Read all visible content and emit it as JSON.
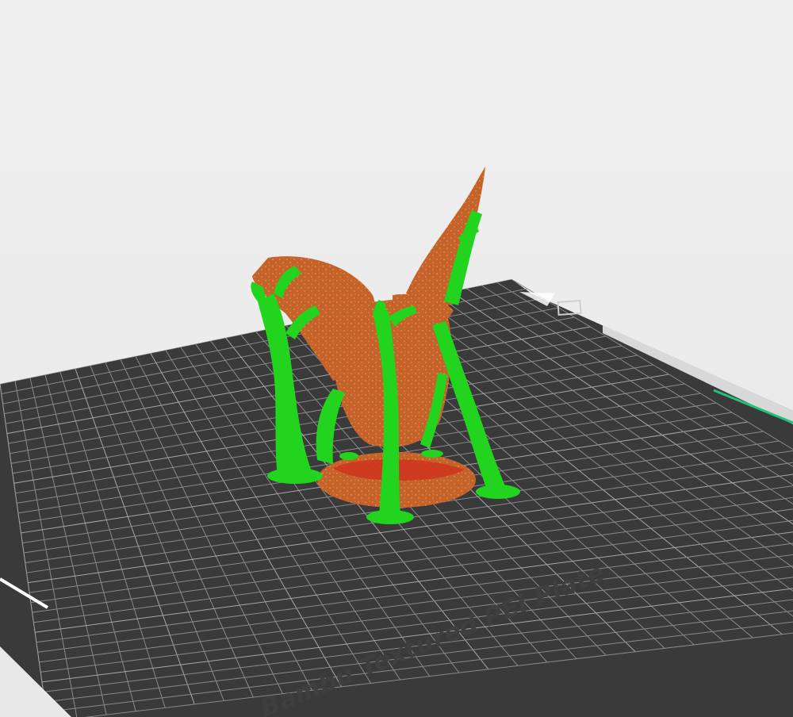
{
  "app": {
    "view": "3D Preview"
  },
  "build_plate": {
    "label": "Bambu Textured PEI Plate",
    "surface_color": "#3a3a3a",
    "grid_color": "#8a8a8a"
  },
  "model": {
    "object_color": "#c4622a",
    "support_color": "#22d41e",
    "overhang_color": "#e03020"
  },
  "viewport": {
    "background_color": "#ececec"
  }
}
